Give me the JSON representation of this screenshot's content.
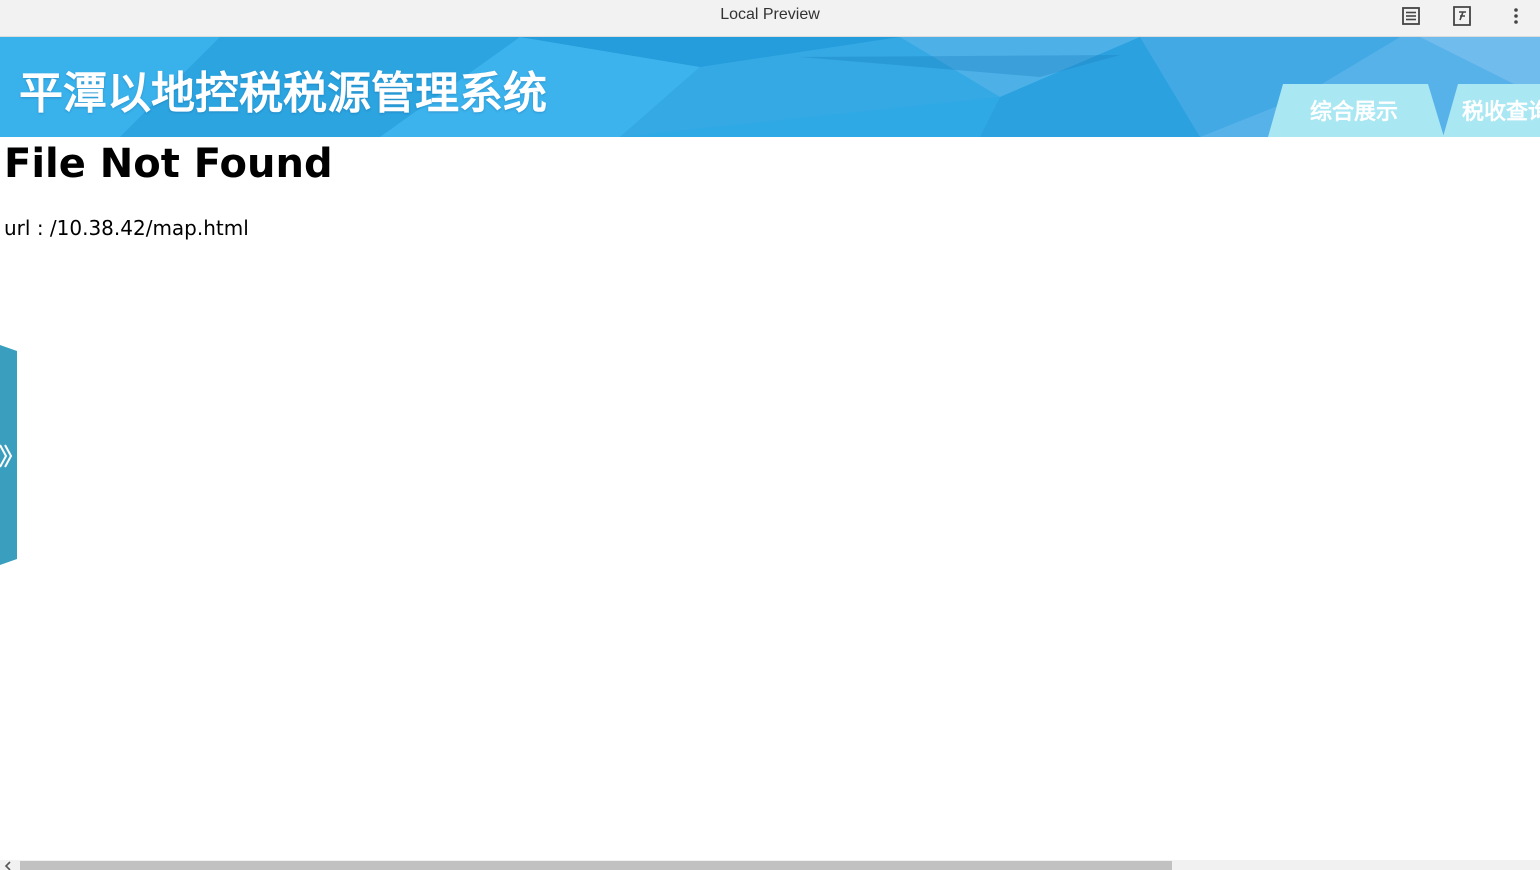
{
  "window": {
    "title": "Local Preview",
    "icons": [
      "reader-mode-icon",
      "formula-icon",
      "more-vert-icon"
    ]
  },
  "header": {
    "system_title": "平潭以地控税税源管理系统",
    "nav_tabs": [
      {
        "label": "综合展示"
      },
      {
        "label": "税收查询"
      }
    ],
    "colors": {
      "banner_blue": "#2fa9e6",
      "tab_light_cyan": "#a9e7f2",
      "side_toggle_teal": "#3a9fbf"
    }
  },
  "main": {
    "heading": "File Not Found",
    "url_line": "url : /10.38.42/map.html"
  },
  "side_toggle": {
    "icon": "double-chevron-right-icon"
  }
}
